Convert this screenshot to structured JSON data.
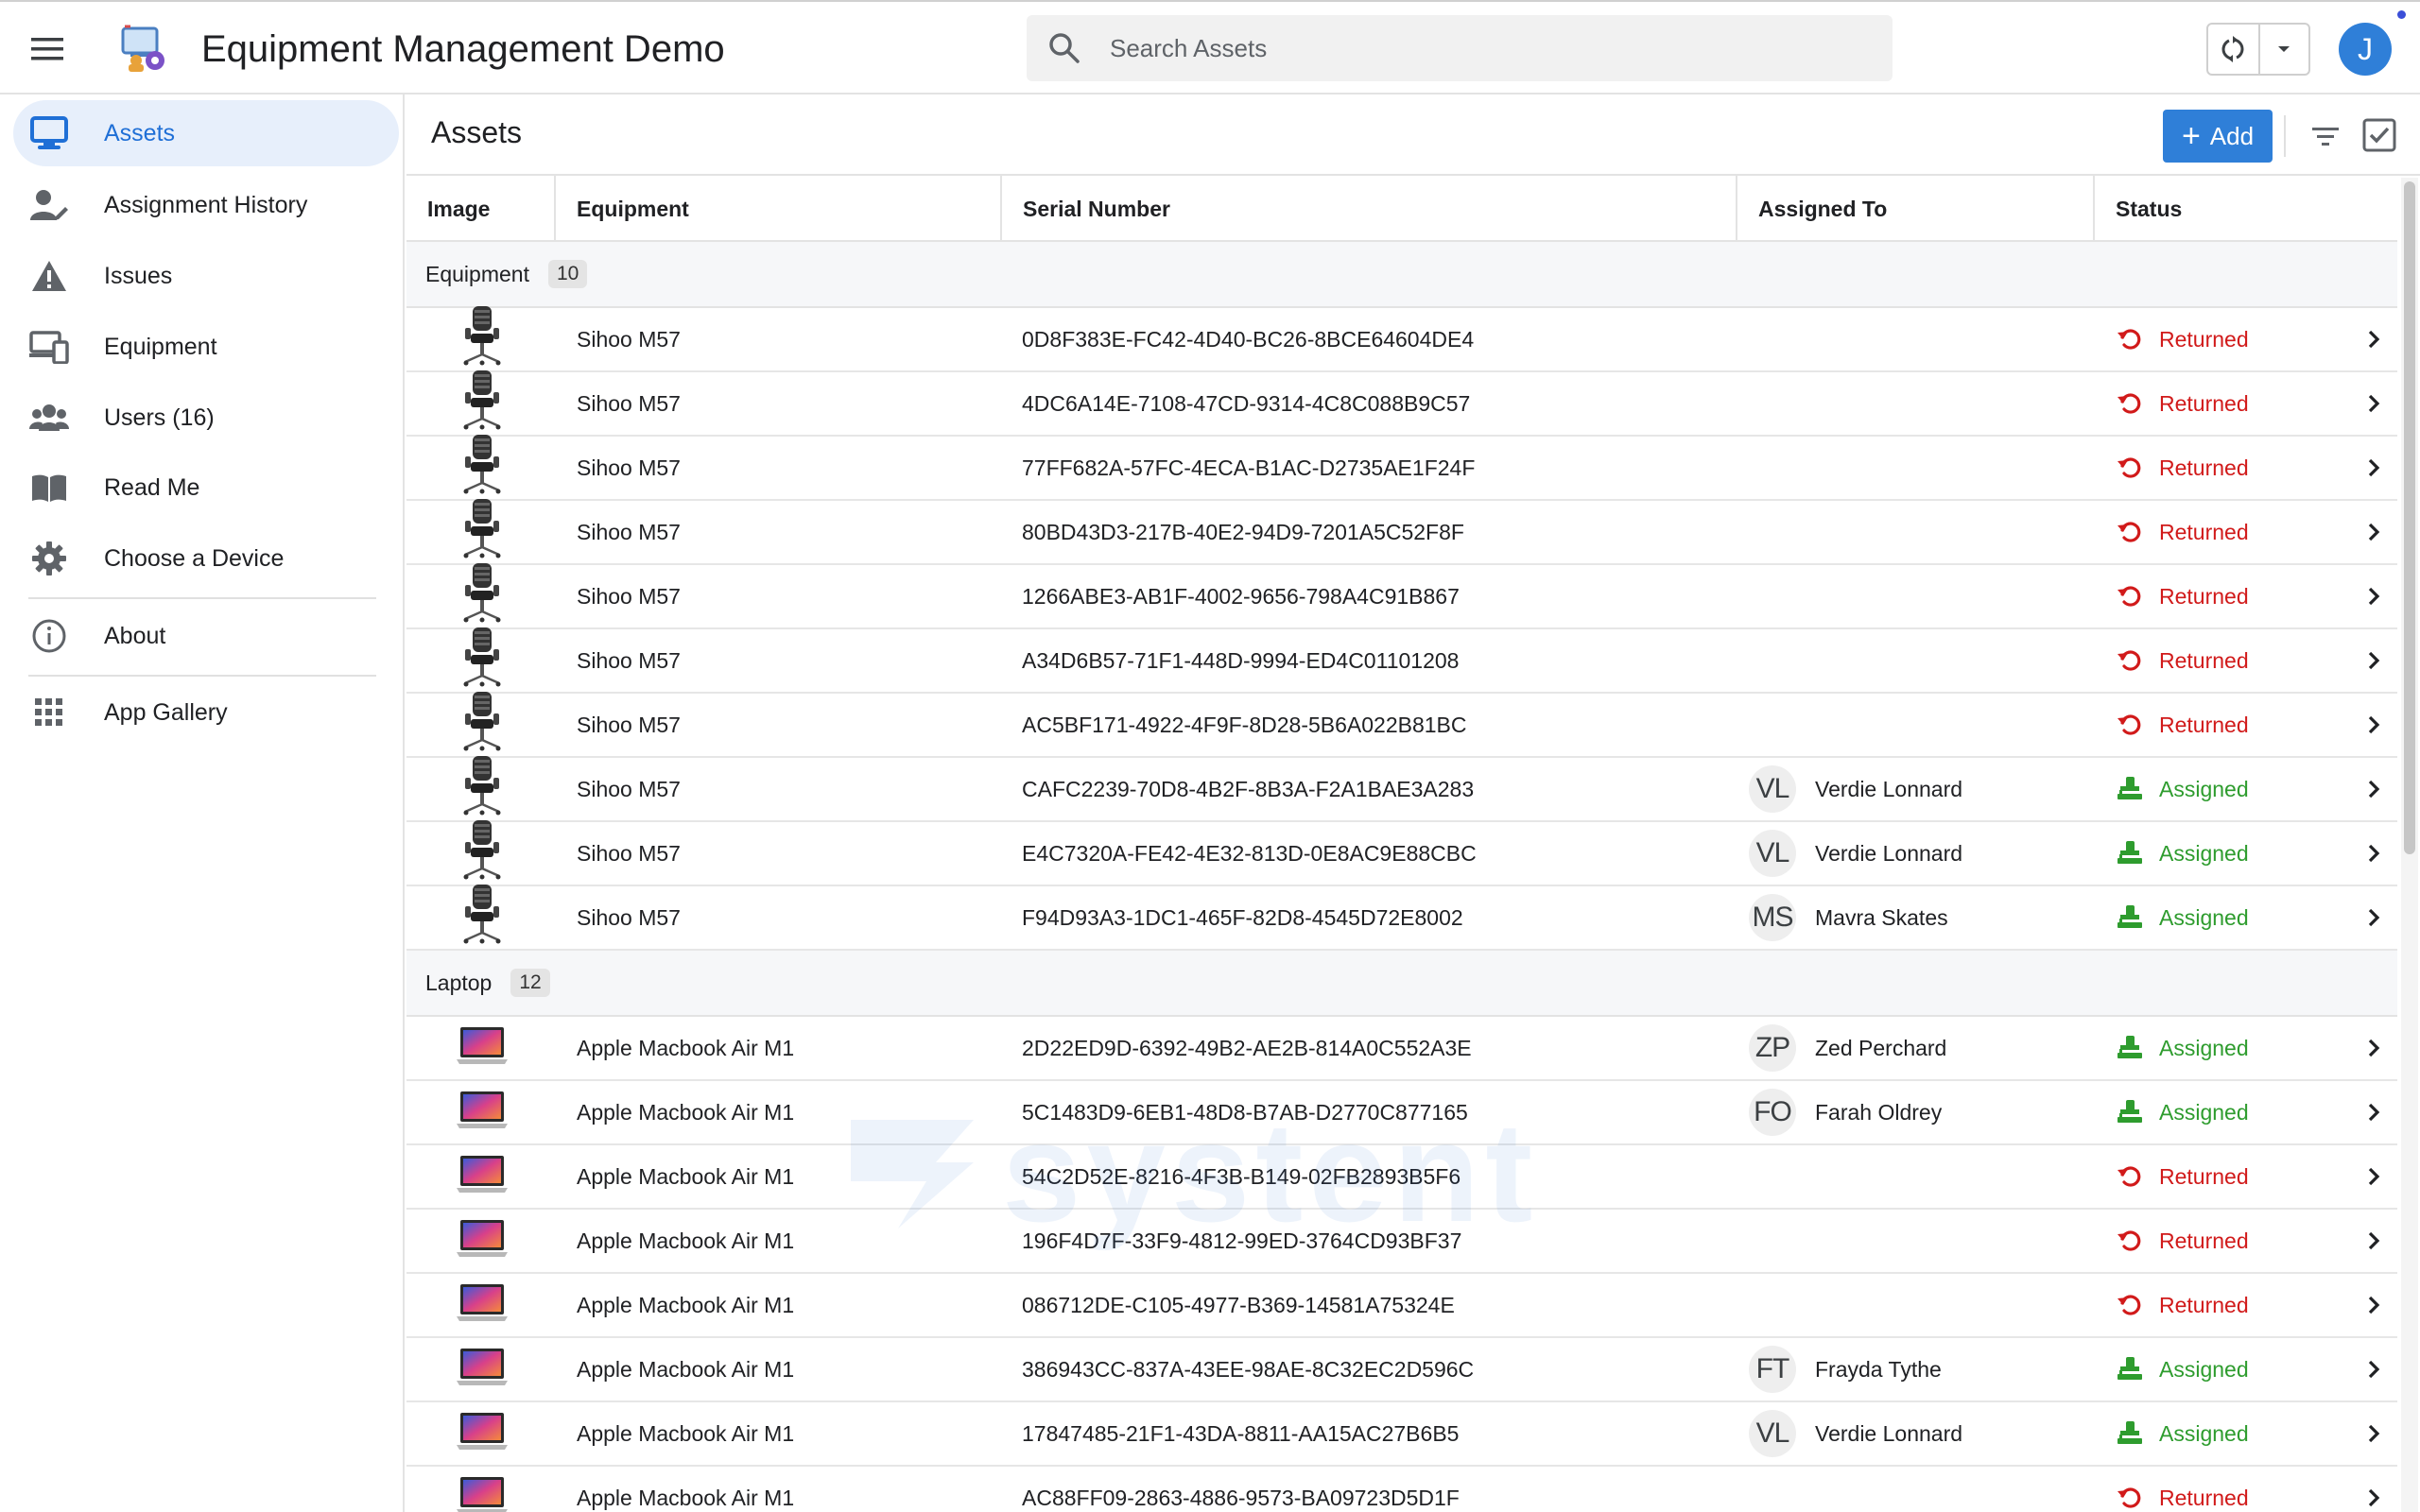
{
  "app": {
    "title": "Equipment Management Demo",
    "user_initial": "J",
    "accent_color": "#2f7fd8"
  },
  "search": {
    "placeholder": "Search Assets"
  },
  "sidebar": {
    "items": [
      {
        "label": "Assets",
        "icon": "monitor-icon",
        "active": true
      },
      {
        "label": "Assignment History",
        "icon": "user-edit-icon"
      },
      {
        "label": "Issues",
        "icon": "warning-icon"
      },
      {
        "label": "Equipment",
        "icon": "devices-icon"
      },
      {
        "label": "Users (16)",
        "icon": "users-icon"
      },
      {
        "label": "Read Me",
        "icon": "book-icon"
      },
      {
        "label": "Choose a Device",
        "icon": "gear-icon"
      },
      {
        "label": "About",
        "icon": "info-icon"
      },
      {
        "label": "App Gallery",
        "icon": "grid-icon"
      }
    ]
  },
  "main": {
    "title": "Assets",
    "add_label": "Add",
    "columns": [
      "Image",
      "Equipment",
      "Serial Number",
      "Assigned To",
      "Status"
    ],
    "groups": [
      {
        "label": "Equipment",
        "count": "10",
        "image": "office-chair",
        "rows": [
          {
            "equipment": "Sihoo M57",
            "serial": "0D8F383E-FC42-4D40-BC26-8BCE64604DE4",
            "initials": "",
            "assignee": "",
            "status": "Returned"
          },
          {
            "equipment": "Sihoo M57",
            "serial": "4DC6A14E-7108-47CD-9314-4C8C088B9C57",
            "initials": "",
            "assignee": "",
            "status": "Returned"
          },
          {
            "equipment": "Sihoo M57",
            "serial": "77FF682A-57FC-4ECA-B1AC-D2735AE1F24F",
            "initials": "",
            "assignee": "",
            "status": "Returned"
          },
          {
            "equipment": "Sihoo M57",
            "serial": "80BD43D3-217B-40E2-94D9-7201A5C52F8F",
            "initials": "",
            "assignee": "",
            "status": "Returned"
          },
          {
            "equipment": "Sihoo M57",
            "serial": "1266ABE3-AB1F-4002-9656-798A4C91B867",
            "initials": "",
            "assignee": "",
            "status": "Returned"
          },
          {
            "equipment": "Sihoo M57",
            "serial": "A34D6B57-71F1-448D-9994-ED4C01101208",
            "initials": "",
            "assignee": "",
            "status": "Returned"
          },
          {
            "equipment": "Sihoo M57",
            "serial": "AC5BF171-4922-4F9F-8D28-5B6A022B81BC",
            "initials": "",
            "assignee": "",
            "status": "Returned"
          },
          {
            "equipment": "Sihoo M57",
            "serial": "CAFC2239-70D8-4B2F-8B3A-F2A1BAE3A283",
            "initials": "VL",
            "assignee": "Verdie Lonnard",
            "status": "Assigned"
          },
          {
            "equipment": "Sihoo M57",
            "serial": "E4C7320A-FE42-4E32-813D-0E8AC9E88CBC",
            "initials": "VL",
            "assignee": "Verdie Lonnard",
            "status": "Assigned"
          },
          {
            "equipment": "Sihoo M57",
            "serial": "F94D93A3-1DC1-465F-82D8-4545D72E8002",
            "initials": "MS",
            "assignee": "Mavra Skates",
            "status": "Assigned"
          }
        ]
      },
      {
        "label": "Laptop",
        "count": "12",
        "image": "laptop",
        "rows": [
          {
            "equipment": "Apple Macbook Air M1",
            "serial": "2D22ED9D-6392-49B2-AE2B-814A0C552A3E",
            "initials": "ZP",
            "assignee": "Zed Perchard",
            "status": "Assigned"
          },
          {
            "equipment": "Apple Macbook Air M1",
            "serial": "5C1483D9-6EB1-48D8-B7AB-D2770C877165",
            "initials": "FO",
            "assignee": "Farah Oldrey",
            "status": "Assigned"
          },
          {
            "equipment": "Apple Macbook Air M1",
            "serial": "54C2D52E-8216-4F3B-B149-02FB2893B5F6",
            "initials": "",
            "assignee": "",
            "status": "Returned"
          },
          {
            "equipment": "Apple Macbook Air M1",
            "serial": "196F4D7F-33F9-4812-99ED-3764CD93BF37",
            "initials": "",
            "assignee": "",
            "status": "Returned"
          },
          {
            "equipment": "Apple Macbook Air M1",
            "serial": "086712DE-C105-4977-B369-14581A75324E",
            "initials": "",
            "assignee": "",
            "status": "Returned"
          },
          {
            "equipment": "Apple Macbook Air M1",
            "serial": "386943CC-837A-43EE-98AE-8C32EC2D596C",
            "initials": "FT",
            "assignee": "Frayda Tythe",
            "status": "Assigned"
          },
          {
            "equipment": "Apple Macbook Air M1",
            "serial": "17847485-21F1-43DA-8811-AA15AC27B6B5",
            "initials": "VL",
            "assignee": "Verdie Lonnard",
            "status": "Assigned"
          },
          {
            "equipment": "Apple Macbook Air M1",
            "serial": "AC88FF09-2863-4886-9573-BA09723D5D1F",
            "initials": "",
            "assignee": "",
            "status": "Returned"
          }
        ]
      }
    ]
  },
  "watermark": "systent",
  "colors": {
    "returned": "#d11a1a",
    "assigned": "#2e9c2e",
    "active_nav_bg": "#e7effb"
  }
}
